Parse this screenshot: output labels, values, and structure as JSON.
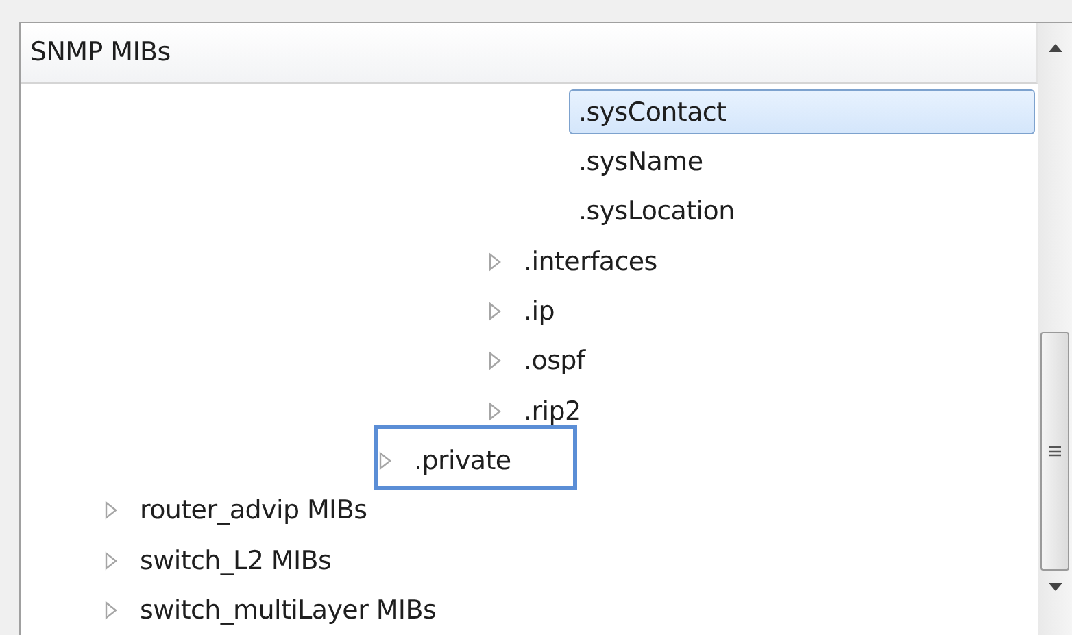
{
  "panel": {
    "header": "SNMP MIBs"
  },
  "tree": {
    "items": [
      {
        "children": [
          {
            "children": [
              {
                "children": [
                  {
                    "children": [
                      {
                        "children": [
                          {
                            "children": [
                              {
                                "children": [
                                  {
                                    "children": [
                                      {
                                        "label": ".sysContact",
                                        "selected": true,
                                        "outlined": false
                                      },
                                      {
                                        "label": ".sysName",
                                        "selected": false,
                                        "outlined": false
                                      },
                                      {
                                        "label": ".sysLocation",
                                        "selected": false,
                                        "outlined": false
                                      }
                                    ]
                                  },
                                  {
                                    "label": ".interfaces",
                                    "expanded": false,
                                    "selected": false,
                                    "outlined": false
                                  },
                                  {
                                    "label": ".ip",
                                    "expanded": false,
                                    "selected": false,
                                    "outlined": false
                                  },
                                  {
                                    "label": ".ospf",
                                    "expanded": false,
                                    "selected": false,
                                    "outlined": false
                                  },
                                  {
                                    "label": ".rip2",
                                    "expanded": false,
                                    "selected": false,
                                    "outlined": false
                                  }
                                ]
                              }
                            ]
                          },
                          {
                            "label": ".private",
                            "expanded": false,
                            "selected": false,
                            "outlined": true
                          }
                        ]
                      }
                    ]
                  }
                ]
              }
            ]
          }
        ]
      },
      {
        "label": "router_advip MIBs",
        "expanded": false,
        "selected": false,
        "outlined": false
      },
      {
        "label": "switch_L2 MIBs",
        "expanded": false,
        "selected": false,
        "outlined": false
      },
      {
        "label": "switch_multiLayer MIBs",
        "expanded": false,
        "selected": false,
        "outlined": false
      }
    ]
  }
}
